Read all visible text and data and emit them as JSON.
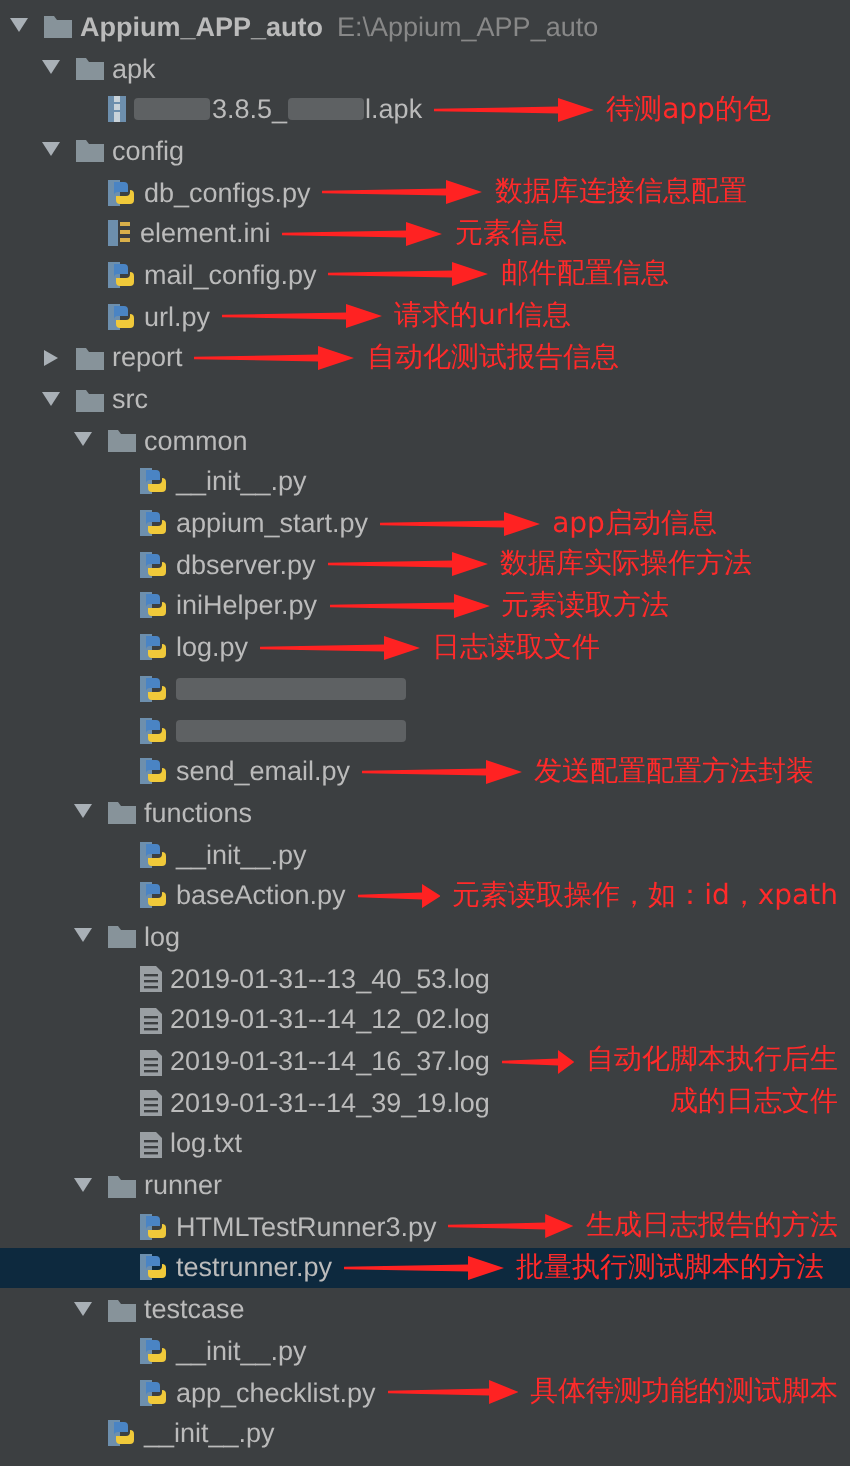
{
  "project_tree": {
    "root": {
      "name": "Appium_APP_auto",
      "path": "E:\\Appium_APP_auto",
      "kind": "folder",
      "expanded": true,
      "selected": false,
      "children": [
        {
          "name": "apk",
          "kind": "folder",
          "expanded": true,
          "selected": false,
          "children": [
            {
              "kind": "apk",
              "parts": [
                "3.8.5_",
                "l.apk"
              ],
              "selected": false,
              "note": "待测app的包"
            }
          ]
        },
        {
          "name": "config",
          "kind": "folder",
          "expanded": true,
          "selected": false,
          "children": [
            {
              "name": "db_configs.py",
              "kind": "python",
              "selected": false,
              "note": "数据库连接信息配置"
            },
            {
              "name": "element.ini",
              "kind": "ini",
              "selected": false,
              "note": "元素信息"
            },
            {
              "name": "mail_config.py",
              "kind": "python",
              "selected": false,
              "note": "邮件配置信息"
            },
            {
              "name": "url.py",
              "kind": "python",
              "selected": false,
              "note": "请求的url信息"
            }
          ]
        },
        {
          "name": "report",
          "kind": "folder",
          "expanded": false,
          "selected": false,
          "note": "自动化测试报告信息"
        },
        {
          "name": "src",
          "kind": "folder",
          "expanded": true,
          "selected": false,
          "children": [
            {
              "name": "common",
              "kind": "folder",
              "expanded": true,
              "selected": false,
              "children": [
                {
                  "name": "__init__.py",
                  "kind": "python",
                  "selected": false
                },
                {
                  "name": "appium_start.py",
                  "kind": "python",
                  "selected": false,
                  "note": "app启动信息"
                },
                {
                  "name": "dbserver.py",
                  "kind": "python",
                  "selected": false,
                  "note": "数据库实际操作方法"
                },
                {
                  "name": "iniHelper.py",
                  "kind": "python",
                  "selected": false,
                  "note": "元素读取方法"
                },
                {
                  "name": "log.py",
                  "kind": "python",
                  "selected": false,
                  "note": "日志读取文件"
                },
                {
                  "kind": "python",
                  "blurred": true,
                  "selected": false
                },
                {
                  "kind": "python",
                  "blurred": true,
                  "selected": false
                },
                {
                  "name": "send_email.py",
                  "kind": "python",
                  "selected": false,
                  "note": "发送配置配置方法封装"
                }
              ]
            },
            {
              "name": "functions",
              "kind": "folder",
              "expanded": true,
              "selected": false,
              "children": [
                {
                  "name": "__init__.py",
                  "kind": "python",
                  "selected": false
                },
                {
                  "name": "baseAction.py",
                  "kind": "python",
                  "selected": false,
                  "note": "元素读取操作，如：id，xpath"
                }
              ]
            },
            {
              "name": "log",
              "kind": "folder",
              "expanded": true,
              "selected": false,
              "children": [
                {
                  "name": "2019-01-31--13_40_53.log",
                  "kind": "log",
                  "selected": false
                },
                {
                  "name": "2019-01-31--14_12_02.log",
                  "kind": "log",
                  "selected": false
                },
                {
                  "name": "2019-01-31--14_16_37.log",
                  "kind": "log",
                  "selected": false,
                  "note": "自动化脚本执行后生"
                },
                {
                  "name": "2019-01-31--14_39_19.log",
                  "kind": "log",
                  "selected": false,
                  "note": "成的日志文件",
                  "arrow": false
                },
                {
                  "name": "log.txt",
                  "kind": "log",
                  "selected": false
                }
              ]
            },
            {
              "name": "runner",
              "kind": "folder",
              "expanded": true,
              "selected": false,
              "children": [
                {
                  "name": "HTMLTestRunner3.py",
                  "kind": "python",
                  "selected": false,
                  "note": "生成日志报告的方法"
                },
                {
                  "name": "testrunner.py",
                  "kind": "python",
                  "selected": true,
                  "note": "批量执行测试脚本的方法"
                }
              ]
            },
            {
              "name": "testcase",
              "kind": "folder",
              "expanded": true,
              "selected": false,
              "children": [
                {
                  "name": "__init__.py",
                  "kind": "python",
                  "selected": false
                },
                {
                  "name": "app_checklist.py",
                  "kind": "python",
                  "selected": false,
                  "note": "具体待测功能的测试脚本"
                }
              ]
            },
            {
              "name": "__init__.py",
              "kind": "python",
              "selected": false
            }
          ]
        }
      ]
    }
  }
}
